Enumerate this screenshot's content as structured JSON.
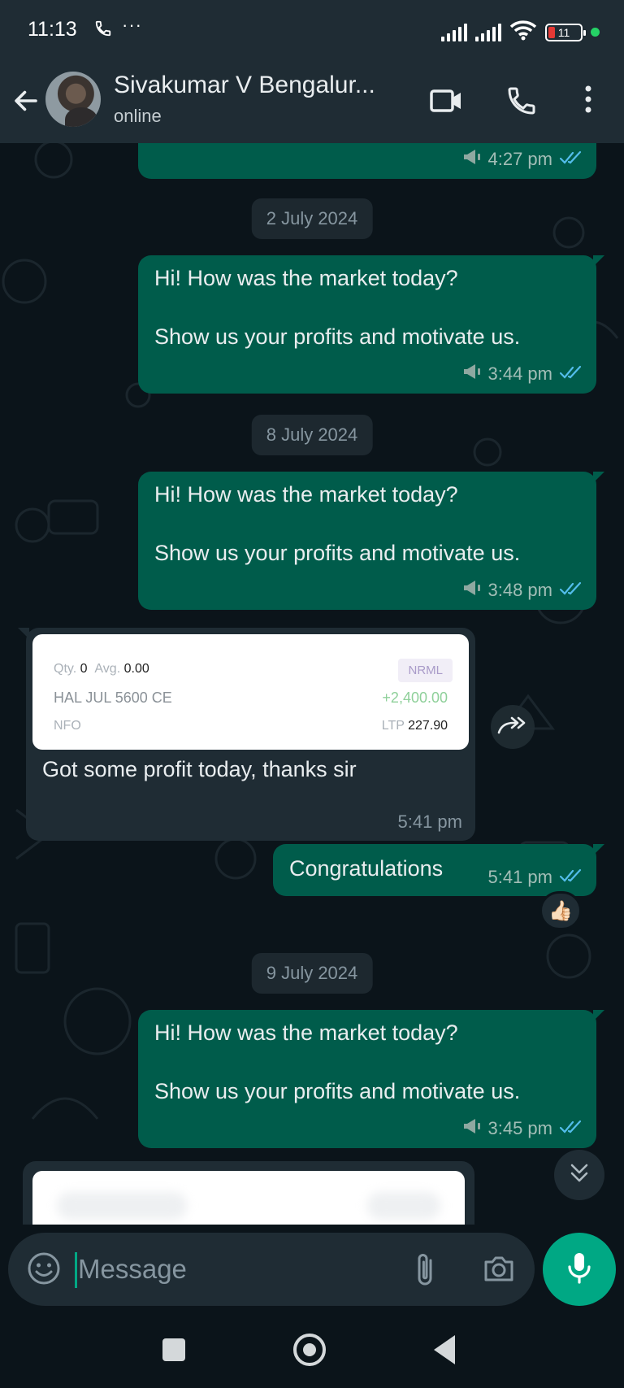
{
  "status_bar": {
    "time": "11:13",
    "more": "···",
    "battery": "11"
  },
  "header": {
    "contact_name": "Sivakumar V Bengalur...",
    "status": "online"
  },
  "messages": {
    "top_partial": {
      "time": "4:27 pm"
    },
    "date1": "2 July 2024",
    "m1": {
      "text": "Hi! How was the market today?\n\nShow us your profits and motivate us.",
      "time": "3:44 pm"
    },
    "date2": "8 July 2024",
    "m2": {
      "text": "Hi! How was the market today?\n\nShow us your profits and motivate us.",
      "time": "3:48 pm"
    },
    "m3": {
      "card": {
        "qty_label": "Qty.",
        "qty": "0",
        "avg_label": "Avg.",
        "avg": "0.00",
        "product": "NRML",
        "instrument": "HAL JUL 5600 CE",
        "pnl": "+2,400.00",
        "exchange": "NFO",
        "ltp_label": "LTP",
        "ltp": "227.90"
      },
      "text": "Got some profit today, thanks sir",
      "time": "5:41 pm"
    },
    "m4": {
      "text": "Congratulations",
      "time": "5:41 pm",
      "reaction": "👍🏻"
    },
    "date3": "9 July 2024",
    "m5": {
      "text": "Hi! How was the market today?\n\nShow us your profits and motivate us.",
      "time": "3:45 pm"
    }
  },
  "composer": {
    "placeholder": "Message"
  },
  "icons": {
    "read_receipt": "double-check-icon",
    "broadcast": "megaphone-icon",
    "forward": "forward-icon",
    "scroll": "chevrons-down-icon"
  },
  "colors": {
    "accent": "#00a884",
    "outgoing_bubble": "#005c4b",
    "incoming_bubble": "#1f2c34",
    "read_tick": "#53bdeb"
  }
}
